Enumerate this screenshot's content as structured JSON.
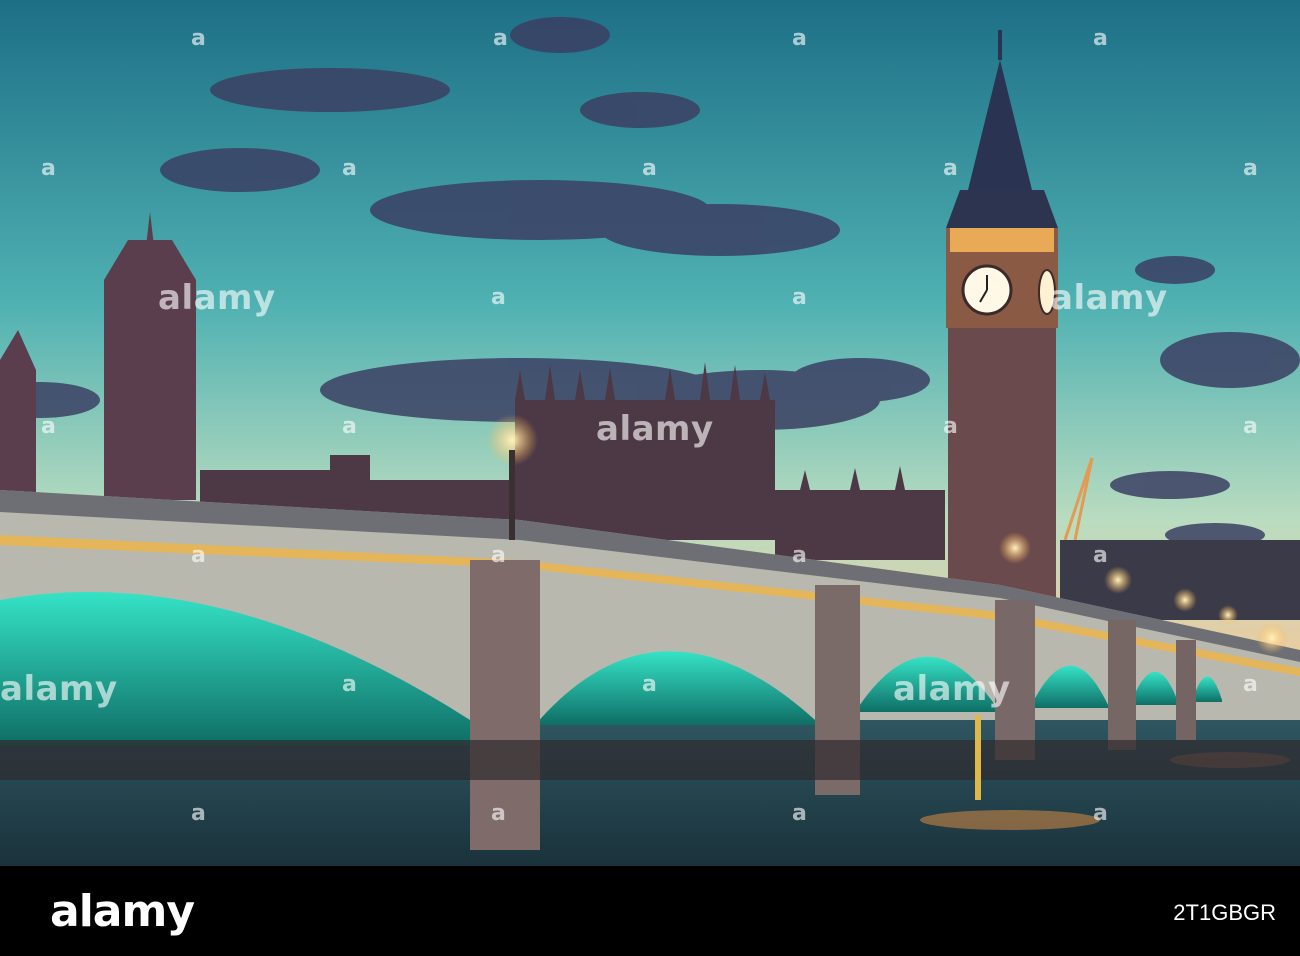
{
  "watermark": {
    "text": "alamy",
    "mark": "a"
  },
  "footer": {
    "brand": "alamy",
    "stock_id": "2T1GBGR"
  },
  "colors": {
    "sky_top": "#1f7f8f",
    "sky_mid": "#7fd0c4",
    "sky_horizon": "#f0c89a",
    "bridge_underlight": "#2ee6c8",
    "stone": "#8a7a82",
    "water": "#2a4b57"
  }
}
